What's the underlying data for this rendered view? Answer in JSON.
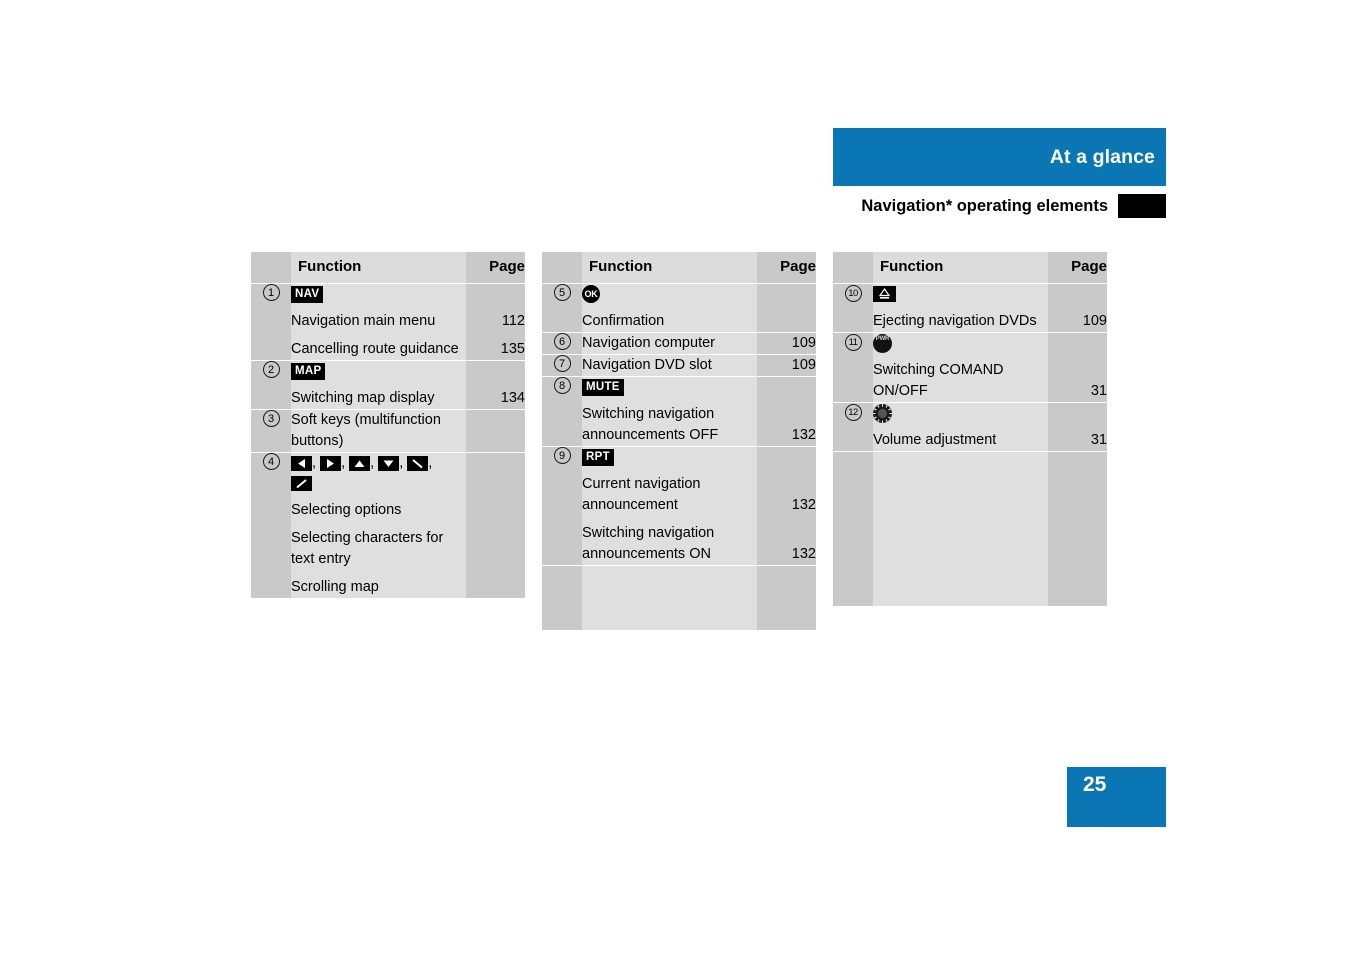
{
  "header": {
    "banner_title": "At a glance",
    "subtitle": "Navigation* operating elements"
  },
  "page_number": "25",
  "table_headers": {
    "function": "Function",
    "page": "Page"
  },
  "columns": [
    {
      "id": "column-1",
      "rows": [
        {
          "num": "1",
          "badge": "NAV",
          "lines": [
            {
              "text": "Navigation main menu",
              "page": "112"
            },
            {
              "text": "Cancelling route guidance",
              "page": "135"
            }
          ]
        },
        {
          "num": "2",
          "badge": "MAP",
          "lines": [
            {
              "text": "Switching map display",
              "page": "134"
            }
          ]
        },
        {
          "num": "3",
          "badge": "",
          "lines": [
            {
              "text": "Soft keys (multifunction buttons)",
              "page": ""
            }
          ]
        },
        {
          "num": "4",
          "badge": "arrow-keys",
          "lines": [
            {
              "text": "Selecting options",
              "page": ""
            },
            {
              "text": "Selecting characters for text entry",
              "page": ""
            },
            {
              "text": "Scrolling map",
              "page": ""
            }
          ]
        }
      ]
    },
    {
      "id": "column-2",
      "rows": [
        {
          "num": "5",
          "badge": "ok-button",
          "lines": [
            {
              "text": "Confirmation",
              "page": ""
            }
          ]
        },
        {
          "num": "6",
          "badge": "",
          "lines": [
            {
              "text": "Navigation computer",
              "page": "109"
            }
          ]
        },
        {
          "num": "7",
          "badge": "",
          "lines": [
            {
              "text": "Navigation DVD slot",
              "page": "109"
            }
          ]
        },
        {
          "num": "8",
          "badge": "MUTE",
          "lines": [
            {
              "text": "Switching navigation announcements OFF",
              "page": "132"
            }
          ]
        },
        {
          "num": "9",
          "badge": "RPT",
          "lines": [
            {
              "text": "Current navigation announcement",
              "page": "132"
            },
            {
              "text": "Switching navigation announcements ON",
              "page": "132"
            }
          ]
        }
      ]
    },
    {
      "id": "column-3",
      "rows": [
        {
          "num": "10",
          "badge": "eject-button",
          "lines": [
            {
              "text": "Ejecting navigation DVDs",
              "page": "109"
            }
          ]
        },
        {
          "num": "11",
          "badge": "power-button",
          "lines": [
            {
              "text": "Switching COMAND ON/OFF",
              "page": "31"
            }
          ]
        },
        {
          "num": "12",
          "badge": "volume-knob",
          "lines": [
            {
              "text": "Volume adjustment",
              "page": "31"
            }
          ]
        }
      ]
    }
  ],
  "icon_labels": {
    "ok": "OK",
    "pwr_top": "PWR",
    "pwr_bottom": ""
  },
  "colors": {
    "accent_blue": "#0a76b4",
    "row_light": "#dfdfdf",
    "row_dark": "#c9c9c9",
    "badge_black": "#000000"
  }
}
